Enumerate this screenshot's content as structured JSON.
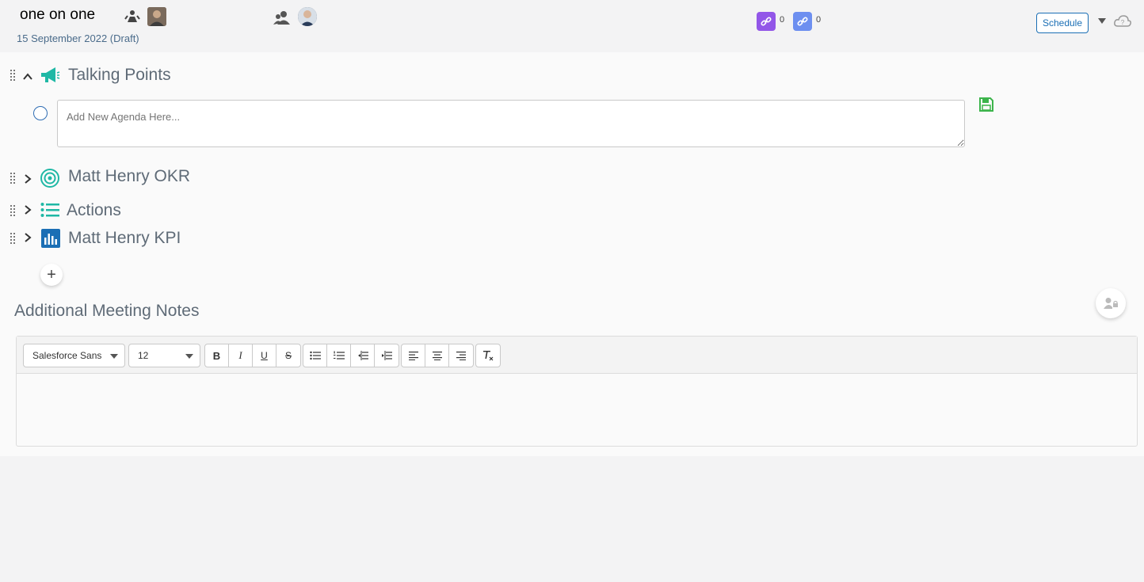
{
  "header": {
    "title": "one on one",
    "subtitle": "15 September 2022 (Draft)",
    "link_counts": [
      "0",
      "0"
    ],
    "schedule_label": "Schedule"
  },
  "sections": [
    {
      "label": "Talking Points",
      "icon": "megaphone-icon",
      "expanded": true
    },
    {
      "label": "Matt Henry OKR",
      "icon": "target-icon",
      "expanded": false
    },
    {
      "label": "Actions",
      "icon": "list-icon",
      "expanded": false
    },
    {
      "label": "Matt Henry  KPI",
      "icon": "bar-chart-icon",
      "expanded": false
    }
  ],
  "agenda": {
    "placeholder": "Add New Agenda Here...",
    "value": ""
  },
  "add_button_label": "+",
  "notes": {
    "title": "Additional Meeting Notes"
  },
  "editor": {
    "font_family": "Salesforce Sans",
    "font_size": "12",
    "format_buttons": [
      "B",
      "I",
      "U",
      "S"
    ]
  },
  "colors": {
    "accent_teal": "#1fb8a5",
    "link_purple": "#9256e8",
    "link_blue": "#6d8ff0",
    "save_green": "#3cb44b",
    "schedule_blue": "#1b6fb5"
  }
}
